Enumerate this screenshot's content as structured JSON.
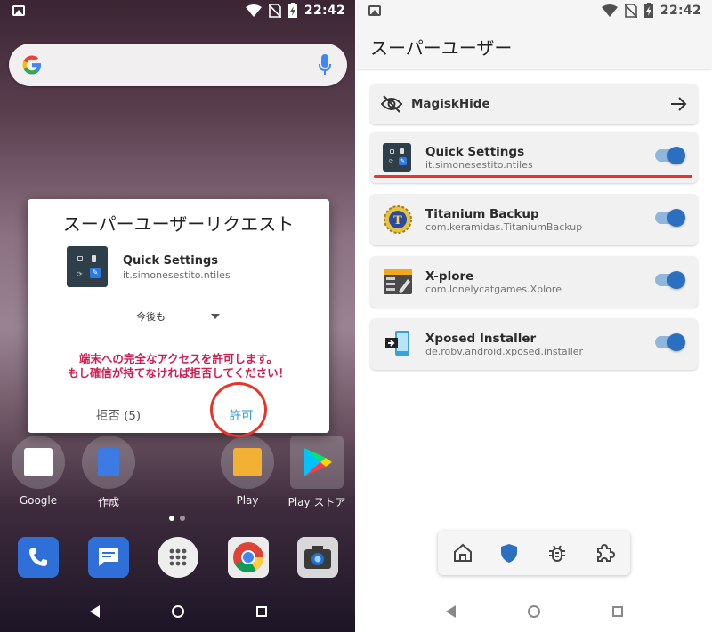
{
  "left": {
    "status": {
      "time": "22:42",
      "icons": [
        "image-icon",
        "wifi-icon",
        "no-sim-icon",
        "battery-charging-icon"
      ]
    },
    "search": {
      "logo": "google-g-icon",
      "mic": "mic-icon"
    },
    "dialog": {
      "title": "スーパーユーザーリクエスト",
      "app_name": "Quick Settings",
      "app_package": "it.simonesestito.ntiles",
      "duration": "今後も",
      "warning_line1": "端末への完全なアクセスを許可します。",
      "warning_line2": "もし確信が持てなければ拒否してください！",
      "deny_label": "拒否 (5)",
      "allow_label": "許可"
    },
    "home_apps": [
      {
        "label": "Google"
      },
      {
        "label": "作成"
      },
      {
        "label": "Play"
      },
      {
        "label": "Play ストア"
      }
    ],
    "dock": [
      "phone-icon",
      "messages-icon",
      "app-drawer-icon",
      "chrome-icon",
      "camera-icon"
    ]
  },
  "right": {
    "status": {
      "time": "22:42"
    },
    "title": "スーパーユーザー",
    "magiskhide_label": "MagiskHide",
    "apps": [
      {
        "name": "Quick Settings",
        "package": "it.simonesestito.ntiles",
        "enabled": true
      },
      {
        "name": "Titanium Backup",
        "package": "com.keramidas.TitaniumBackup",
        "enabled": true
      },
      {
        "name": "X-plore",
        "package": "com.lonelycatgames.Xplore",
        "enabled": true
      },
      {
        "name": "Xposed Installer",
        "package": "de.robv.android.xposed.installer",
        "enabled": true
      }
    ],
    "bottom_nav": [
      "home-icon",
      "shield-icon",
      "bug-icon",
      "puzzle-icon"
    ]
  },
  "colors": {
    "accent": "#2a9bd6",
    "warning": "#cf1d52",
    "highlight": "#e8352a",
    "toggle": "#2b6fc1"
  }
}
